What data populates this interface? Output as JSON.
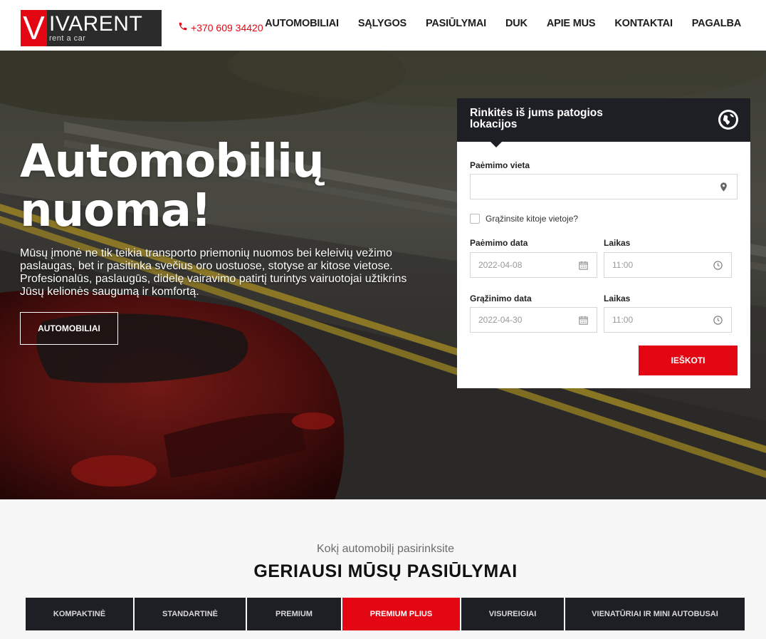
{
  "header": {
    "logo": {
      "letter": "V",
      "word": "IVARENT",
      "tagline": "rent a car"
    },
    "phone": "+370 609 34420",
    "nav": [
      "AUTOMOBILIAI",
      "SĄLYGOS",
      "PASIŪLYMAI",
      "DUK",
      "APIE MUS",
      "KONTAKTAI",
      "PAGALBA"
    ]
  },
  "hero": {
    "title_line1": "Automobilių",
    "title_line2": "nuoma!",
    "text": "Mūsų įmonė ne tik teikia transporto priemonių nuomos bei keleivių vežimo paslaugas, bet ir pasitinka svečius oro uostuose, stotyse ar kitose vietose. Profesionalūs, paslaugūs, didelę vairavimo patirtį turintys vairuotojai užtikrins Jūsų kelionės saugumą ir komfortą.",
    "button": "AUTOMOBILIAI"
  },
  "booking": {
    "title": "Rinkitės iš jums patogios lokacijos",
    "pickup_label": "Paėmimo vieta",
    "pickup_value": "",
    "return_other": "Grąžinsite kitoje vietoje?",
    "pickup_date_label": "Paėmimo data",
    "pickup_date": "2022-04-08",
    "pickup_time_label": "Laikas",
    "pickup_time": "11:00",
    "return_date_label": "Grąžinimo data",
    "return_date": "2022-04-30",
    "return_time_label": "Laikas",
    "return_time": "11:00",
    "search_button": "IEŠKOTI"
  },
  "offers": {
    "subtitle": "Kokį automobilį pasirinksite",
    "title": "GERIAUSI MŪSŲ PASIŪLYMAI",
    "tabs": [
      "KOMPAKTINĖ",
      "STANDARTINĖ",
      "PREMIUM",
      "PREMIUM PLIUS",
      "VISUREIGIAI",
      "VIENATŪRIAI IR MINI AUTOBUSAI"
    ],
    "active_tab": "PREMIUM PLIUS"
  },
  "colors": {
    "accent": "#e30613",
    "dark": "#1d1f25"
  }
}
